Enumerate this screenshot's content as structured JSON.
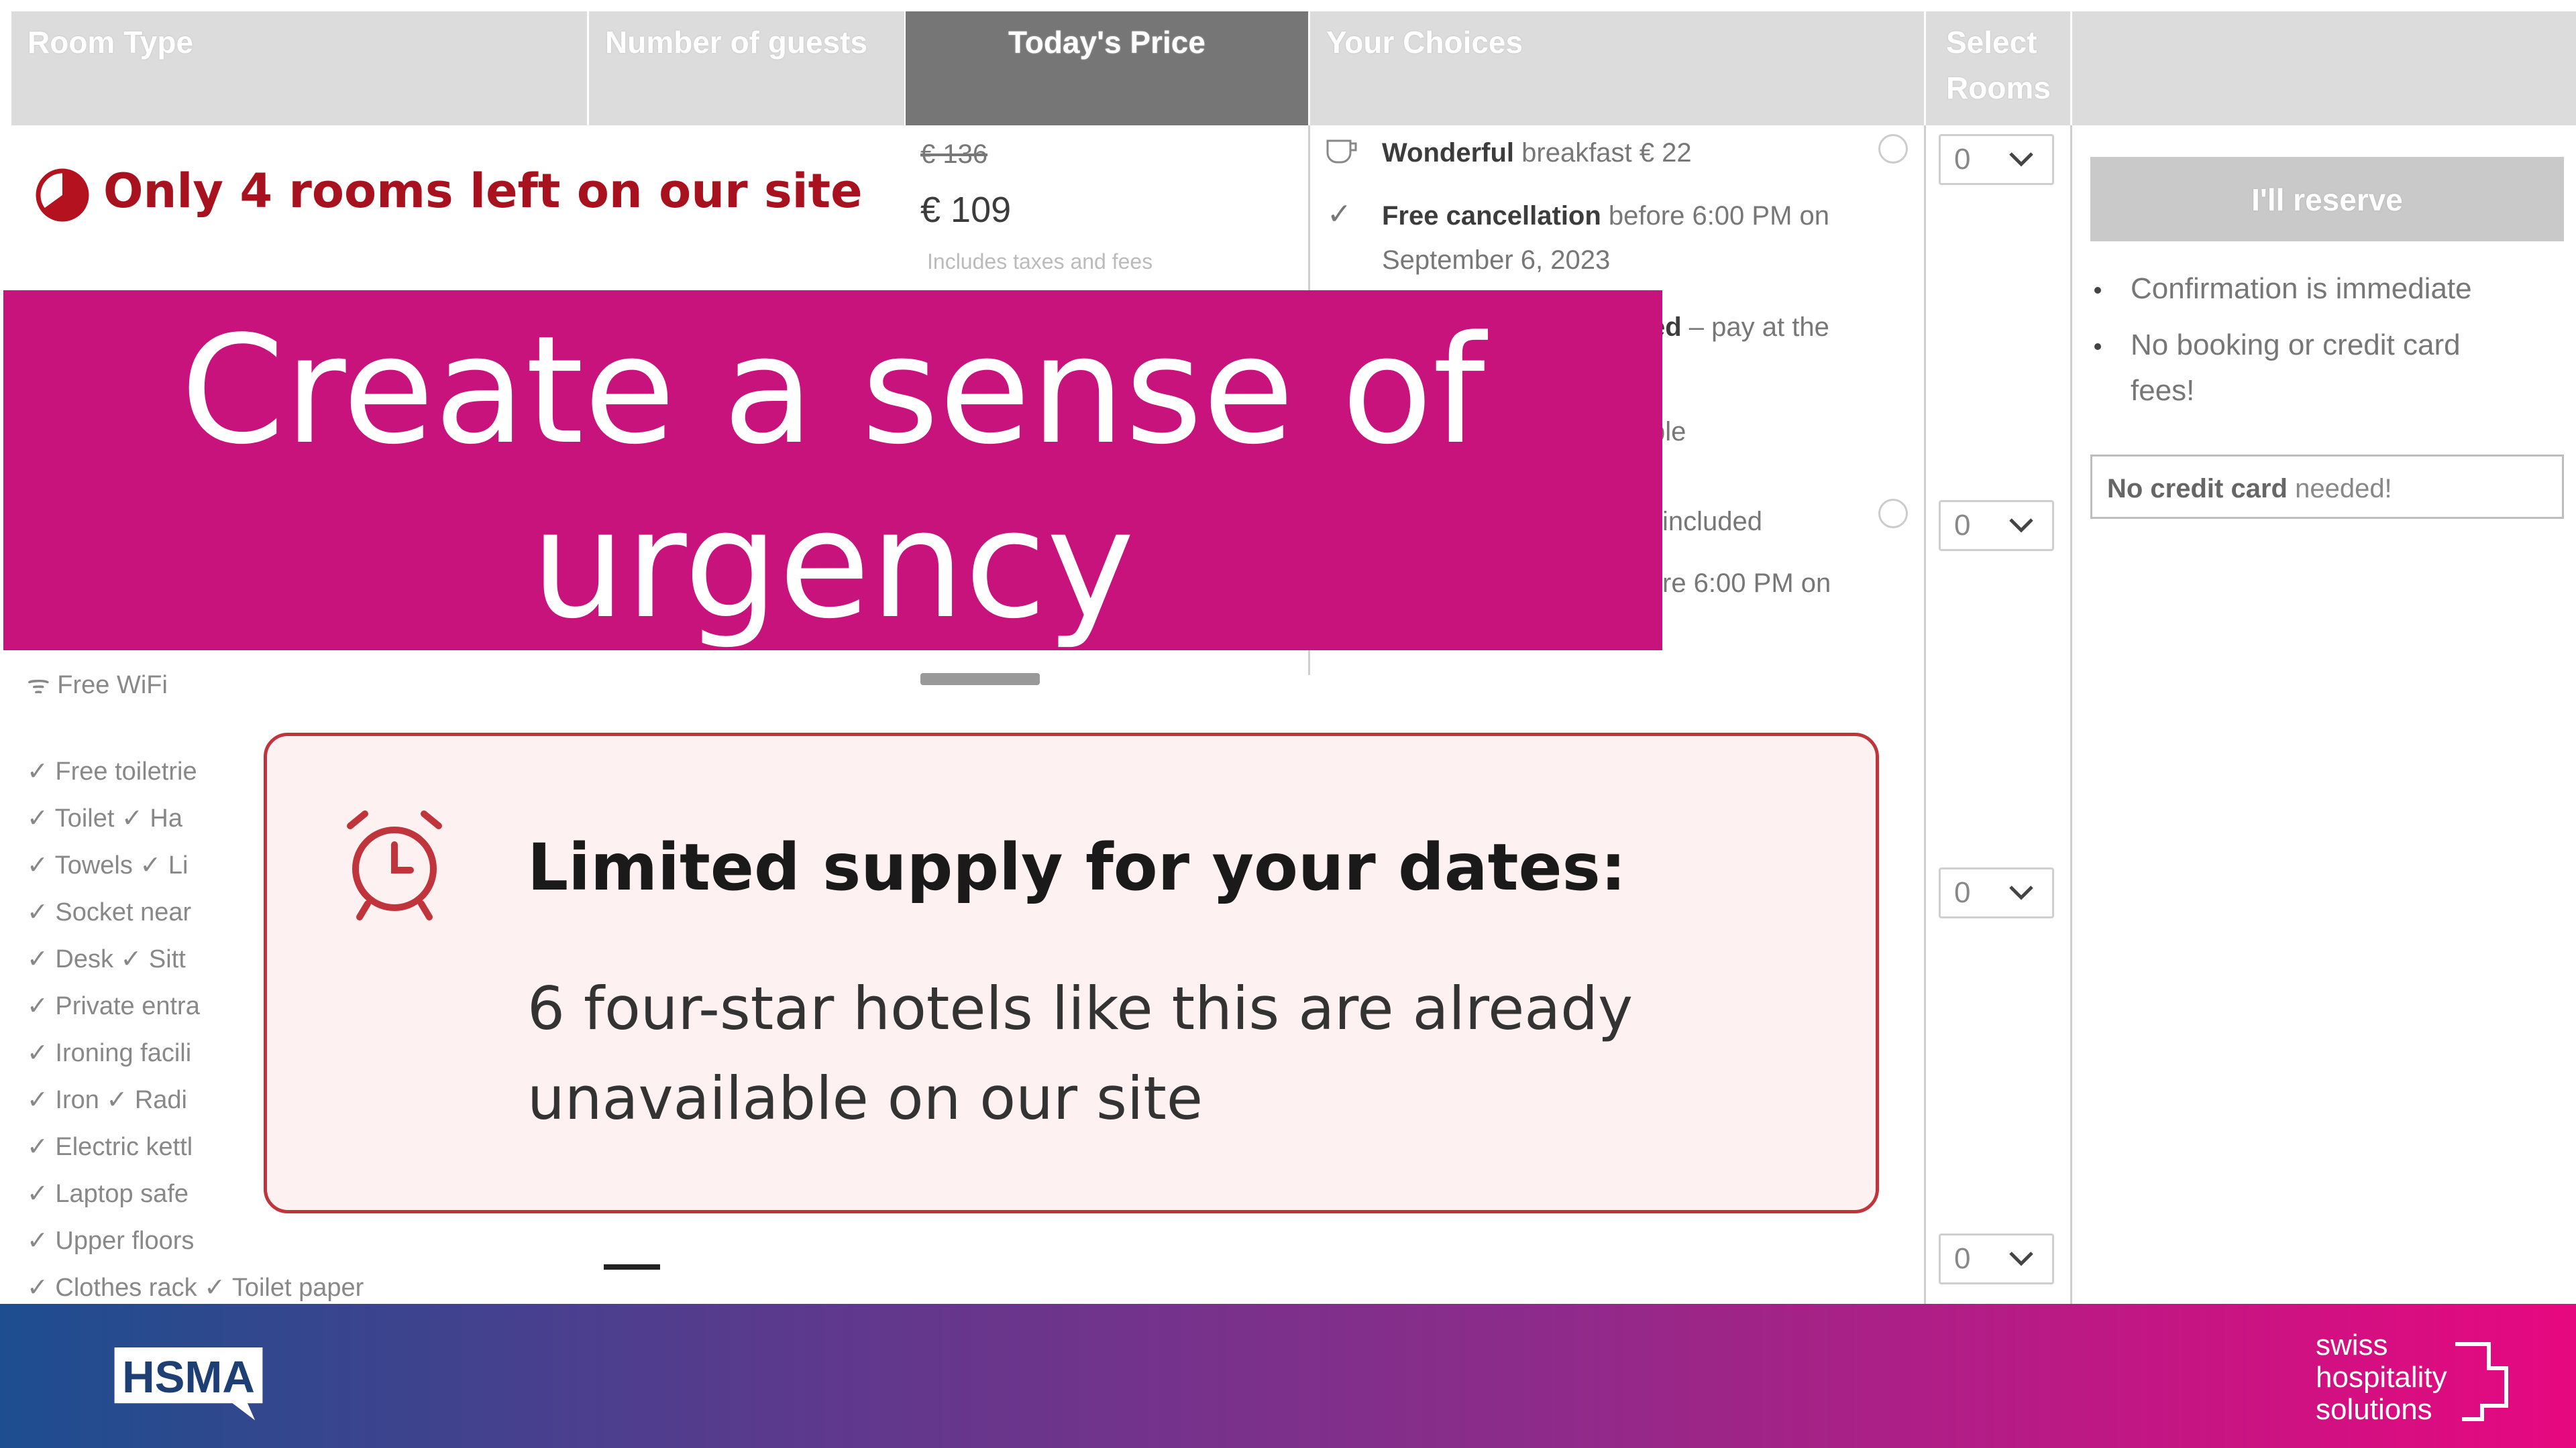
{
  "table": {
    "headers": {
      "room_type": "Room Type",
      "guests": "Number of guests",
      "price": "Today's Price",
      "choices": "Your Choices",
      "select": "Select Rooms"
    },
    "price": {
      "old": "€ 136",
      "current": "€ 109",
      "taxes": "Includes taxes and fees"
    },
    "choices": {
      "breakfast_bold": "Wonderful",
      "breakfast_rest": " breakfast € 22",
      "cancel_bold": "Free cancellation",
      "cancel_rest": " before 6:00 PM on",
      "cancel_date": "September 6, 2023",
      "frag_prepay": "ed – pay at the",
      "frag_ble": "ble",
      "frag_included": "included",
      "frag_before": "re 6:00 PM on"
    },
    "select_values": [
      "0",
      "0",
      "0",
      "0"
    ],
    "reserve": {
      "button": "I'll reserve",
      "bullet1": "Confirmation is immediate",
      "bullet2_line1": "No booking or credit card",
      "bullet2_line2": "fees!",
      "nocard_bold": "No credit card",
      "nocard_rest": " needed!"
    },
    "amenities": {
      "wifi": "Free WiFi",
      "items": [
        "✓ Free toiletrie",
        "✓ Toilet  ✓ Ha",
        "✓ Towels  ✓ Li",
        "✓ Socket near",
        "✓ Desk  ✓ Sitt",
        "✓ Private entra",
        "✓ Ironing facili",
        "✓ Iron  ✓ Radi",
        "✓ Electric kettl",
        "✓ Laptop safe",
        "✓ Upper floors",
        "✓ Clothes rack  ✓ Toilet paper"
      ]
    }
  },
  "urgency_badge": "Only 4 rooms left on our site",
  "banner_title": "Create a sense of urgency",
  "limited_supply": {
    "title": "Limited supply for your dates:",
    "body": "6 four-star hotels like this are already unavailable on our site"
  },
  "footer": {
    "hsma_logo": "HSMA",
    "partner_line1": "swiss",
    "partner_line2": "hospitality",
    "partner_line3": "solutions"
  },
  "colors": {
    "banner": "#c8127c",
    "urgent_red": "#a8121e",
    "limited_border": "#c0343c",
    "footer_start": "#1d4e8f",
    "footer_end": "#e7087f"
  }
}
